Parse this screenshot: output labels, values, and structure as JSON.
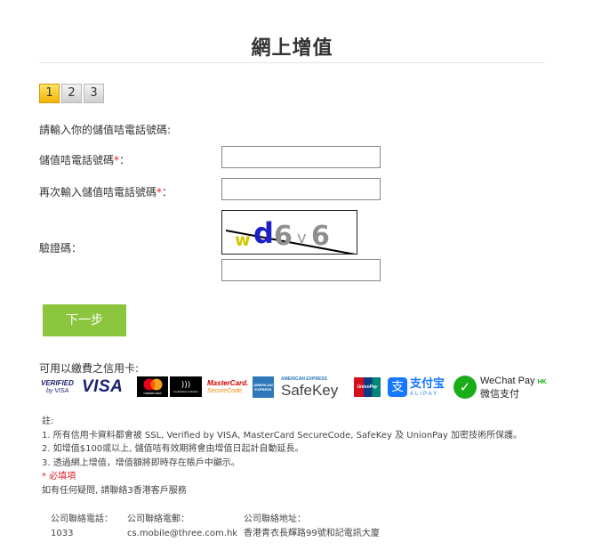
{
  "page": {
    "title": "網上增值"
  },
  "steps": [
    "1",
    "2",
    "3"
  ],
  "form": {
    "prompt": "請輸入你的儲值咭電話號碼:",
    "phone_label": "儲值咭電話號碼",
    "confirm_label": "再次輸入儲值咭電話號碼",
    "captcha_label": "驗證碼：",
    "required_mark": "*",
    "label_colon": "：",
    "captcha_text": "wd6v6",
    "next_button": "下一步"
  },
  "cards": {
    "label": "可用以繳費之信用卡:",
    "items": [
      {
        "name": "verified-by-visa",
        "line1": "VERIFIED",
        "line2": "by VISA"
      },
      {
        "name": "visa",
        "text": "VISA"
      },
      {
        "name": "mastercard",
        "text": "mastercard"
      },
      {
        "name": "contactless",
        "text": "Contactless Indicator"
      },
      {
        "name": "mastercard-securecode",
        "line1": "MasterCard.",
        "line2": "SecureCode."
      },
      {
        "name": "amex",
        "text": "AMERICAN EXPRESS"
      },
      {
        "name": "safekey",
        "line1": "AMERICAN EXPRESS",
        "line2": "SafeKey"
      },
      {
        "name": "unionpay",
        "text": "UnionPay"
      },
      {
        "name": "alipay",
        "line1": "支付宝",
        "line2": "ALIPAY"
      },
      {
        "name": "wechat-pay",
        "line1": "WeChat Pay",
        "badge": "HK",
        "line2": "微信支付"
      }
    ]
  },
  "notes": {
    "heading": "註:",
    "items": [
      "1. 所有信用卡資料都會被 SSL, Verified by VISA, MasterCard SecureCode, SafeKey 及 UnionPay 加密技術所保護。",
      "2. 如增值$100或以上, 儲值咭有效期將會由增值日起計自動延長。",
      "3. 透過網上增值，增值額將即時存在賬戶中顯示。"
    ],
    "required_note": "* 必填項",
    "help": "如有任何疑問, 請聯絡3香港客戶服務"
  },
  "contact": {
    "phone_label": "公司聯絡電話：",
    "phone_value": "1033",
    "email_label": "公司聯絡電郵：",
    "email_value": "cs.mobile@three.com.hk",
    "address_label": "公司聯絡地址：",
    "address_value": "香港青衣長輝路99號和記電訊大廈"
  },
  "colors": {
    "next_button": "#8cc63f",
    "step_active": "#f3b400",
    "required": "#e0202a",
    "visa_blue": "#1a1f71",
    "alipay_blue": "#1677ff",
    "wechat_green": "#1aad19"
  }
}
